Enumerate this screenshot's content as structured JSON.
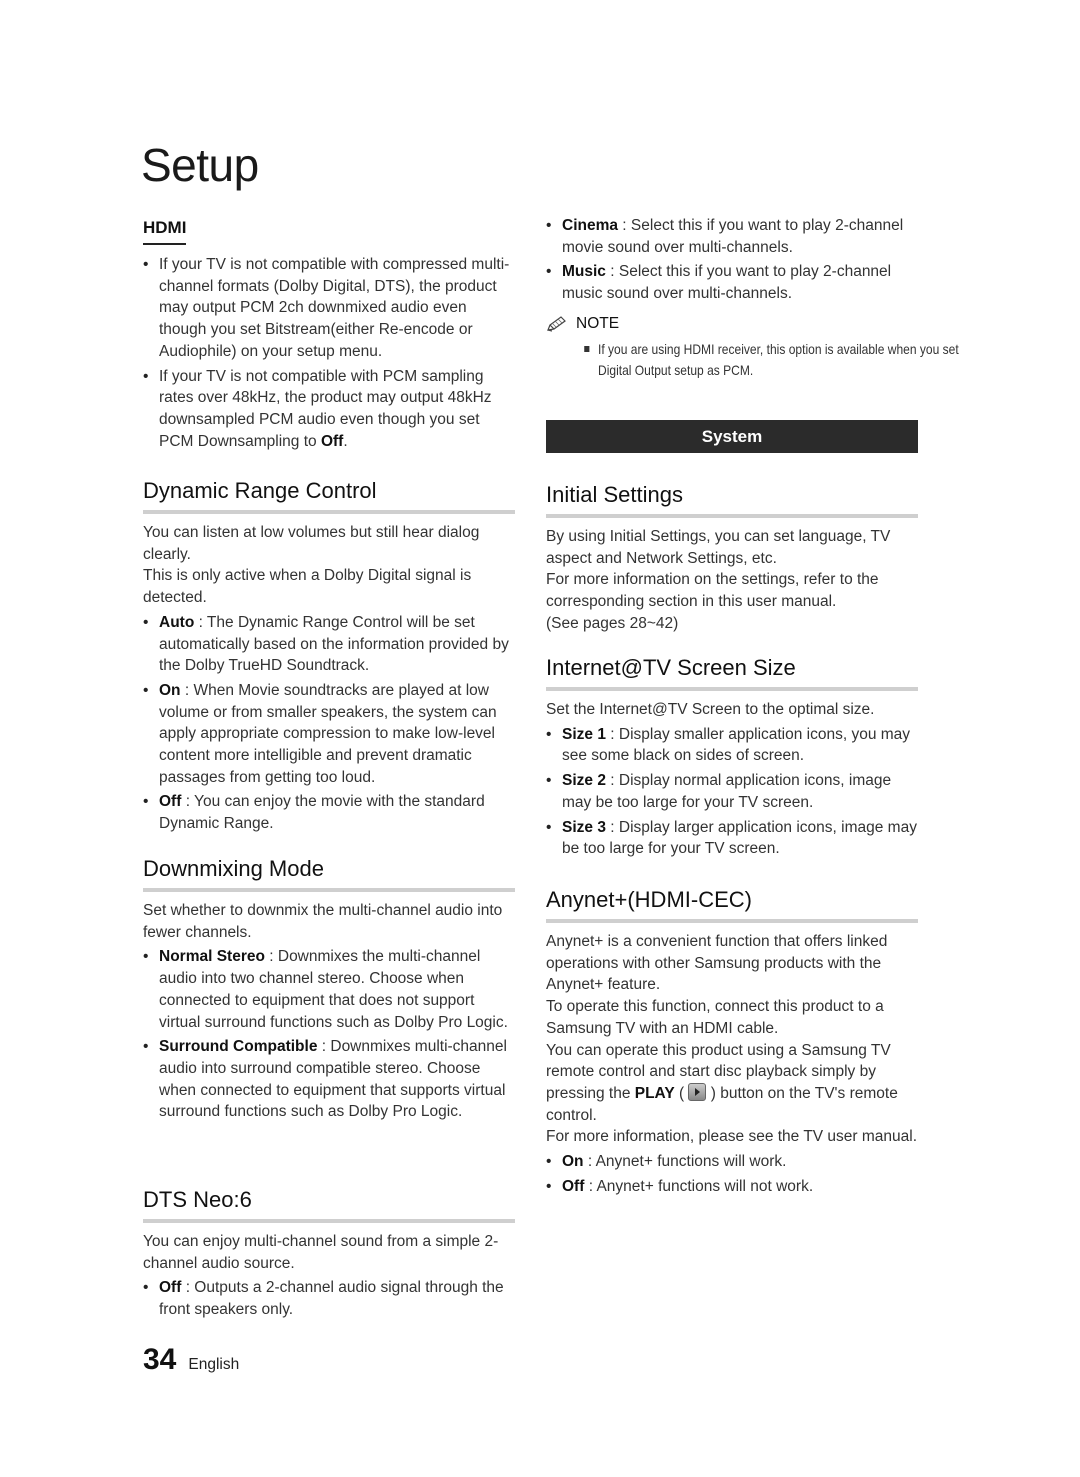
{
  "page_title": "Setup",
  "left": {
    "hdmi": {
      "heading": "HDMI",
      "bullets": [
        "If your TV is not compatible with compressed multi-channel formats (Dolby Digital, DTS), the product may output PCM 2ch downmixed audio even though you set Bitstream(either Re-encode or Audiophile) on your setup menu.",
        "If your TV is not compatible with PCM sampling rates over 48kHz, the product may output 48kHz downsampled PCM audio even though you set PCM Downsampling to "
      ],
      "bullet2_term": "Off",
      "bullet2_end": "."
    },
    "drc": {
      "heading": "Dynamic Range Control",
      "para1": "You can listen at low volumes but still hear dialog clearly.",
      "para2": "This is only active when a Dolby Digital signal is detected.",
      "items": [
        {
          "term": "Auto",
          "text": " : The Dynamic Range Control will be set automatically based on the information provided by the Dolby TrueHD Soundtrack."
        },
        {
          "term": "On",
          "text": " : When Movie soundtracks are played at low volume or from smaller speakers, the system can apply appropriate compression to make low-level content more intelligible and prevent dramatic passages from getting too loud."
        },
        {
          "term": "Off",
          "text": " : You can enjoy the movie with the standard Dynamic Range."
        }
      ]
    },
    "downmix": {
      "heading": "Downmixing Mode",
      "para": "Set whether to downmix the multi-channel audio into fewer channels.",
      "items": [
        {
          "term": "Normal Stereo",
          "text": " : Downmixes the multi-channel audio into two channel stereo. Choose when connected to equipment that does not support virtual surround functions such as Dolby Pro Logic."
        },
        {
          "term": "Surround Compatible",
          "text": " : Downmixes multi-channel audio into surround compatible stereo. Choose when connected to equipment that supports virtual surround functions such as Dolby Pro Logic."
        }
      ]
    },
    "dts": {
      "heading": "DTS Neo:6",
      "para": "You can enjoy multi-channel sound from a simple 2-channel audio source.",
      "items": [
        {
          "term": "Off",
          "text": " : Outputs a 2-channel audio signal through the front speakers only."
        }
      ]
    }
  },
  "right": {
    "cont": {
      "items": [
        {
          "term": "Cinema",
          "text": " : Select this if you want to play 2-channel movie sound over multi-channels."
        },
        {
          "term": "Music",
          "text": " : Select this if you want to play 2-channel music sound over multi-channels."
        }
      ],
      "note_label": "NOTE",
      "note_icon": "pencil-icon",
      "note_text": "If you are using HDMI receiver, this option is available when you set Digital Output setup as PCM."
    },
    "system_bar": "System",
    "initial": {
      "heading": "Initial Settings",
      "para1": "By using Initial Settings, you can set language, TV aspect and Network Settings, etc.",
      "para2": "For more information on the settings, refer to the corresponding section in this user manual.",
      "para3": "(See pages 28~42)"
    },
    "screen_size": {
      "heading": "Internet@TV Screen Size",
      "para": "Set the Internet@TV Screen to the optimal size.",
      "items": [
        {
          "term": "Size 1",
          "text": " : Display smaller application icons, you may see some black on sides of screen."
        },
        {
          "term": "Size 2",
          "text": " : Display normal application icons, image may be too large for your TV screen."
        },
        {
          "term": "Size 3",
          "text": " : Display larger application icons, image may be too large for your TV screen."
        }
      ]
    },
    "anynet": {
      "heading": "Anynet+(HDMI-CEC)",
      "para1": "Anynet+ is a convenient function that offers linked operations with other Samsung products with the Anynet+ feature.",
      "para2": "To operate this function, connect this product to a Samsung TV with an HDMI cable.",
      "para3_start": "You can operate this product using a Samsung TV remote control and start disc playback simply by pressing the ",
      "para3_term": "PLAY",
      "para3_open": " ( ",
      "play_icon": "play-button-icon",
      "para3_end": " ) button on the TV's remote control.",
      "para4": "For more information, please see the TV user manual.",
      "items": [
        {
          "term": "On",
          "text": " : Anynet+ functions will work."
        },
        {
          "term": "Off",
          "text": " : Anynet+ functions will not work."
        }
      ]
    }
  },
  "footer": {
    "page_number": "34",
    "language": "English"
  }
}
